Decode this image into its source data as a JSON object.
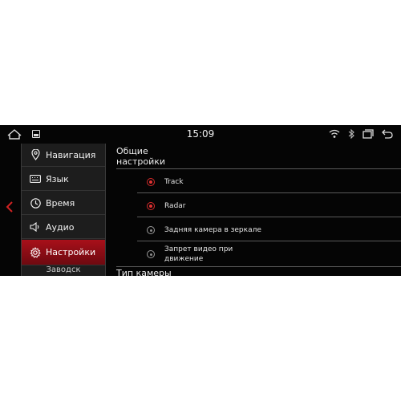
{
  "status_bar": {
    "time": "15:09",
    "icons": [
      "home-icon",
      "image-icon",
      "wifi-icon",
      "bluetooth-icon",
      "recent-apps-icon",
      "back-icon"
    ]
  },
  "sidebar": {
    "items": [
      {
        "label": "Навигация",
        "icon": "location-pin-icon",
        "active": false
      },
      {
        "label": "Язык",
        "icon": "keyboard-icon",
        "active": false
      },
      {
        "label": "Время",
        "icon": "clock-icon",
        "active": false
      },
      {
        "label": "Аудио",
        "icon": "speaker-icon",
        "active": false
      },
      {
        "label": "Настройки",
        "icon": "gear-icon",
        "active": true
      },
      {
        "label": "Заводск",
        "icon": "",
        "active": false
      }
    ]
  },
  "main": {
    "section_general": "Общие настройки",
    "options": [
      {
        "label": "Track",
        "selected": true
      },
      {
        "label": "Radar",
        "selected": true
      },
      {
        "label": "Задняя камера в зеркале",
        "selected": false
      },
      {
        "label": "Запрет видео при движение",
        "selected": false
      }
    ],
    "section_camera": "Тип камеры"
  },
  "colors": {
    "accent": "#e23333",
    "active_item": "#a8101a",
    "sidebar_bg": "#1d1d1d",
    "screen_bg": "#050505"
  }
}
